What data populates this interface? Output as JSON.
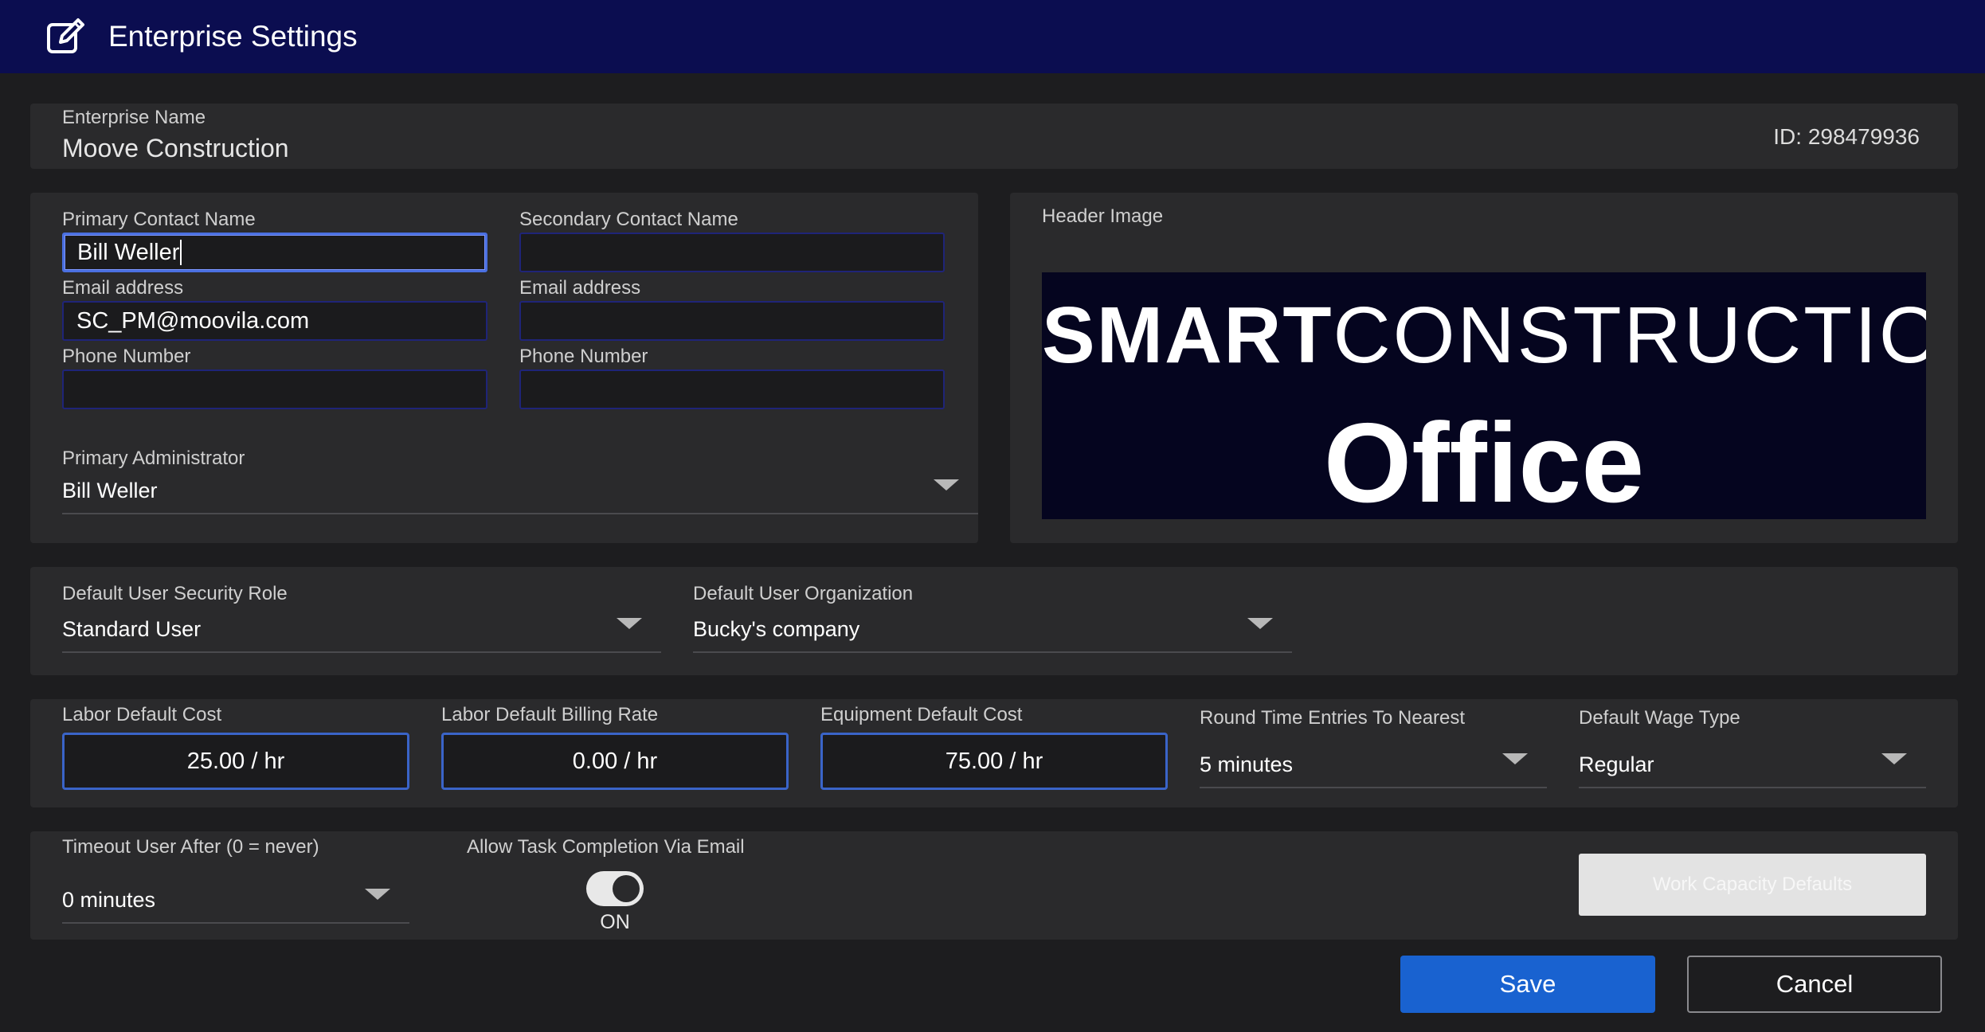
{
  "window": {
    "title": "Enterprise Settings",
    "icon": "edit-icon"
  },
  "enterprise": {
    "name_label": "Enterprise Name",
    "name_value": "Moove Construction",
    "id_text": "ID: 298479936"
  },
  "contacts": {
    "primary": {
      "name_label": "Primary Contact Name",
      "name_value": "Bill Weller",
      "email_label": "Email address",
      "email_value": "SC_PM@moovila.com",
      "phone_label": "Phone Number",
      "phone_value": ""
    },
    "secondary": {
      "name_label": "Secondary Contact Name",
      "name_value": "",
      "email_label": "Email address",
      "email_value": "",
      "phone_label": "Phone Number",
      "phone_value": ""
    },
    "admin_label": "Primary Administrator",
    "admin_value": "Bill Weller"
  },
  "header_image": {
    "label": "Header Image",
    "logo_word_1": "SMART",
    "logo_word_2": "CONSTRUCTION",
    "logo_word_3": "Office"
  },
  "defaults": {
    "security_role_label": "Default User Security Role",
    "security_role_value": "Standard User",
    "organization_label": "Default User Organization",
    "organization_value": "Bucky's company"
  },
  "costs": {
    "labor_cost_label": "Labor Default Cost",
    "labor_cost_value": "25.00 / hr",
    "labor_billing_label": "Labor Default Billing Rate",
    "labor_billing_value": "0.00 / hr",
    "equipment_cost_label": "Equipment Default Cost",
    "equipment_cost_value": "75.00 / hr",
    "round_time_label": "Round Time Entries To Nearest",
    "round_time_value": "5 minutes",
    "wage_type_label": "Default Wage Type",
    "wage_type_value": "Regular"
  },
  "misc": {
    "timeout_label": "Timeout User After (0 = never)",
    "timeout_value": "0 minutes",
    "task_email_label": "Allow Task Completion Via Email",
    "task_email_state": "ON",
    "work_capacity_label": "Work Capacity Defaults"
  },
  "actions": {
    "save_label": "Save",
    "cancel_label": "Cancel"
  },
  "colors": {
    "titlebar": "#0b0d50",
    "accent": "#1962d0",
    "panel": "#2a2a2c",
    "background": "#1d1d1f"
  }
}
